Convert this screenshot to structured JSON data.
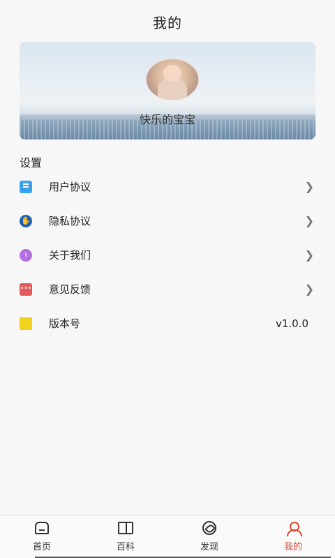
{
  "header": {
    "title": "我的"
  },
  "profile": {
    "nickname": "快乐的宝宝"
  },
  "settings": {
    "title": "设置",
    "items": [
      {
        "label": "用户协议",
        "icon": "document-icon"
      },
      {
        "label": "隐私协议",
        "icon": "hand-icon"
      },
      {
        "label": "关于我们",
        "icon": "info-icon"
      },
      {
        "label": "意见反馈",
        "icon": "chat-icon"
      },
      {
        "label": "版本号",
        "icon": "note-icon",
        "value": "v1.0.0"
      }
    ]
  },
  "tabs": [
    {
      "label": "首页",
      "icon": "home-icon"
    },
    {
      "label": "百科",
      "icon": "book-icon"
    },
    {
      "label": "发现",
      "icon": "compass-icon"
    },
    {
      "label": "我的",
      "icon": "user-icon",
      "active": true
    }
  ],
  "colors": {
    "accent": "#d9482e"
  }
}
